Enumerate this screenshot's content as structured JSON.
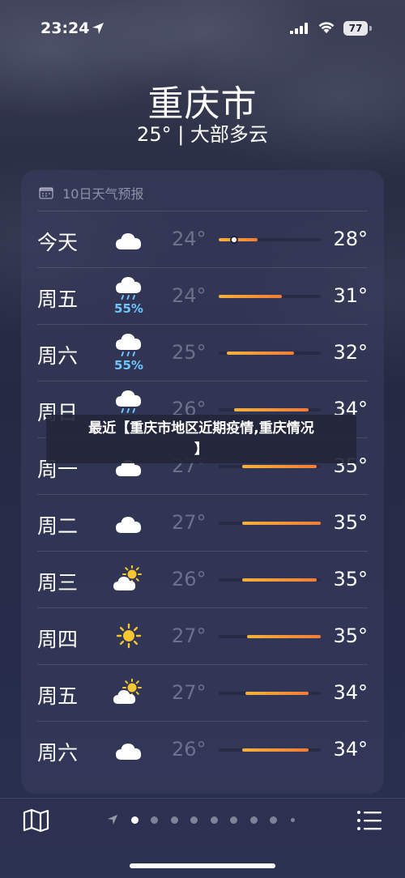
{
  "status": {
    "time": "23:24",
    "battery": "77"
  },
  "header": {
    "city": "重庆市",
    "summary": "25° | 大部多云"
  },
  "forecast": {
    "title": "10日天气预报",
    "days": [
      {
        "day": "今天",
        "icon": "cloud-icon",
        "pop": "",
        "low": "24°",
        "high": "28°",
        "bar_start": 0.0,
        "bar_end": 0.38,
        "current": 0.13
      },
      {
        "day": "周五",
        "icon": "cloud-rain-icon",
        "pop": "55%",
        "low": "24°",
        "high": "31°",
        "bar_start": 0.0,
        "bar_end": 0.62
      },
      {
        "day": "周六",
        "icon": "cloud-rain-icon",
        "pop": "55%",
        "low": "25°",
        "high": "32°",
        "bar_start": 0.08,
        "bar_end": 0.74
      },
      {
        "day": "周日",
        "icon": "cloud-rain-icon",
        "pop": "",
        "low": "26°",
        "high": "34°",
        "bar_start": 0.15,
        "bar_end": 0.88
      },
      {
        "day": "周一",
        "icon": "cloud-icon",
        "pop": "",
        "low": "27°",
        "high": "35°",
        "bar_start": 0.23,
        "bar_end": 0.96
      },
      {
        "day": "周二",
        "icon": "cloud-icon",
        "pop": "",
        "low": "27°",
        "high": "35°",
        "bar_start": 0.23,
        "bar_end": 1.0
      },
      {
        "day": "周三",
        "icon": "partly-sunny-icon",
        "pop": "",
        "low": "26°",
        "high": "35°",
        "bar_start": 0.23,
        "bar_end": 0.96
      },
      {
        "day": "周四",
        "icon": "sun-icon",
        "pop": "",
        "low": "27°",
        "high": "35°",
        "bar_start": 0.28,
        "bar_end": 1.0
      },
      {
        "day": "周五",
        "icon": "partly-sunny-icon",
        "pop": "",
        "low": "27°",
        "high": "34°",
        "bar_start": 0.26,
        "bar_end": 0.88
      },
      {
        "day": "周六",
        "icon": "cloud-icon",
        "pop": "",
        "low": "26°",
        "high": "34°",
        "bar_start": 0.23,
        "bar_end": 0.88
      }
    ]
  },
  "overlay": {
    "title_line1": "最近【重庆市地区近期疫情,重庆情况",
    "title_line2": "】"
  },
  "colors": {
    "bar_cool": "#f3b13c",
    "bar_warm": "#f07c3a",
    "pop": "#6ec6ff"
  },
  "icons": {
    "map": "map-icon",
    "list": "list-icon",
    "location": "location-arrow-icon"
  }
}
